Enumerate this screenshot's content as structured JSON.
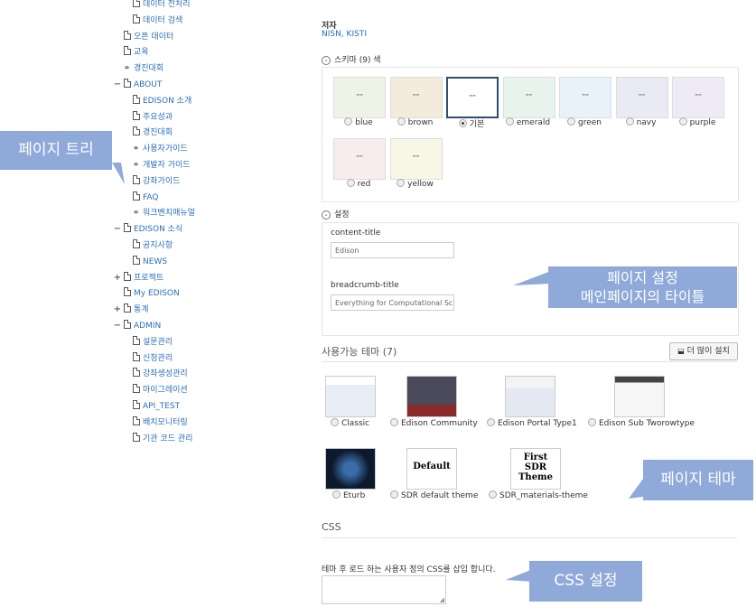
{
  "tree": [
    {
      "label": "데이터 전처리",
      "level": 2,
      "toggle": "",
      "icon": "page"
    },
    {
      "label": "데이터 검색",
      "level": 2,
      "toggle": "",
      "icon": "page"
    },
    {
      "label": "오픈 데이터",
      "level": 1,
      "toggle": "",
      "icon": "page"
    },
    {
      "label": "교육",
      "level": 1,
      "toggle": "",
      "icon": "page"
    },
    {
      "label": "경진대회",
      "level": 1,
      "toggle": "",
      "icon": "link"
    },
    {
      "label": "ABOUT",
      "level": 0,
      "toggle": "−",
      "icon": "page"
    },
    {
      "label": "EDISON 소개",
      "level": 2,
      "toggle": "",
      "icon": "page"
    },
    {
      "label": "주요성과",
      "level": 2,
      "toggle": "",
      "icon": "page"
    },
    {
      "label": "경진대회",
      "level": 2,
      "toggle": "",
      "icon": "page"
    },
    {
      "label": "사용자가이드",
      "level": 2,
      "toggle": "",
      "icon": "link"
    },
    {
      "label": "개발자 가이드",
      "level": 2,
      "toggle": "",
      "icon": "link"
    },
    {
      "label": "강좌가이드",
      "level": 2,
      "toggle": "",
      "icon": "page"
    },
    {
      "label": "FAQ",
      "level": 2,
      "toggle": "",
      "icon": "page"
    },
    {
      "label": "워크벤치매뉴얼",
      "level": 2,
      "toggle": "",
      "icon": "link"
    },
    {
      "label": "EDISON 소식",
      "level": 0,
      "toggle": "−",
      "icon": "page"
    },
    {
      "label": "공지사항",
      "level": 2,
      "toggle": "",
      "icon": "page"
    },
    {
      "label": "NEWS",
      "level": 2,
      "toggle": "",
      "icon": "page"
    },
    {
      "label": "프로젝트",
      "level": 0,
      "toggle": "+",
      "icon": "page"
    },
    {
      "label": "My EDISON",
      "level": 1,
      "toggle": "",
      "icon": "page"
    },
    {
      "label": "통계",
      "level": 0,
      "toggle": "+",
      "icon": "page"
    },
    {
      "label": "ADMIN",
      "level": 0,
      "toggle": "−",
      "icon": "page"
    },
    {
      "label": "설문관리",
      "level": 2,
      "toggle": "",
      "icon": "page"
    },
    {
      "label": "신청관리",
      "level": 2,
      "toggle": "",
      "icon": "page"
    },
    {
      "label": "강좌생성관리",
      "level": 2,
      "toggle": "",
      "icon": "page"
    },
    {
      "label": "마이그레이션",
      "level": 2,
      "toggle": "",
      "icon": "page"
    },
    {
      "label": "API_TEST",
      "level": 2,
      "toggle": "",
      "icon": "page"
    },
    {
      "label": "배치모니터링",
      "level": 2,
      "toggle": "",
      "icon": "page"
    },
    {
      "label": "기관 코드 관리",
      "level": 2,
      "toggle": "",
      "icon": "page"
    }
  ],
  "callouts": {
    "page_tree": "페이지 트리",
    "page_settings_1": "페이지 설정",
    "page_settings_2": "메인페이지의 타이틀",
    "page_theme": "페이지 테마",
    "css_settings": "CSS 설정"
  },
  "author": {
    "label": "저자",
    "value": "NISN, KISTI"
  },
  "schemes": {
    "header": "스키마 (9) 색",
    "items": [
      {
        "name": "blue",
        "color": "#eef3e6",
        "selected": false
      },
      {
        "name": "brown",
        "color": "#f3ecdc",
        "selected": false
      },
      {
        "name": "기본",
        "color": "#ffffff",
        "selected": true
      },
      {
        "name": "emerald",
        "color": "#e9f3ee",
        "selected": false
      },
      {
        "name": "green",
        "color": "#e8f2fa",
        "selected": false
      },
      {
        "name": "navy",
        "color": "#eaeaf4",
        "selected": false
      },
      {
        "name": "purple",
        "color": "#eeebf6",
        "selected": false
      },
      {
        "name": "red",
        "color": "#f8ecef",
        "selected": false
      },
      {
        "name": "yellow",
        "color": "#f8f6e6",
        "selected": false
      }
    ]
  },
  "settings": {
    "header": "설정",
    "content_title_label": "content-title",
    "content_title_value": "Edison",
    "breadcrumb_title_label": "breadcrumb-title",
    "breadcrumb_title_value": "Everything for Computational Science"
  },
  "themes": {
    "header": "사용가능 테마 (7)",
    "install_button": "더 많이 설치",
    "items": [
      {
        "name": "Classic",
        "icon": "classic-theme-thumbnail"
      },
      {
        "name": "Edison Community",
        "icon": "community-theme-thumbnail"
      },
      {
        "name": "Edison Portal Type1",
        "icon": "portal-theme-thumbnail"
      },
      {
        "name": "Edison Sub Tworowtype",
        "icon": "sub-theme-thumbnail"
      },
      {
        "name": "Eturb",
        "icon": "eturb-theme-thumbnail"
      },
      {
        "name": "SDR default theme",
        "thumb_text": "Default"
      },
      {
        "name": "SDR_materials-theme",
        "thumb_text": "First SDR Theme"
      }
    ]
  },
  "css": {
    "header": "CSS",
    "description": "테마 후 로드 하는 사용자 정의 CSS를 삽입 합니다."
  }
}
